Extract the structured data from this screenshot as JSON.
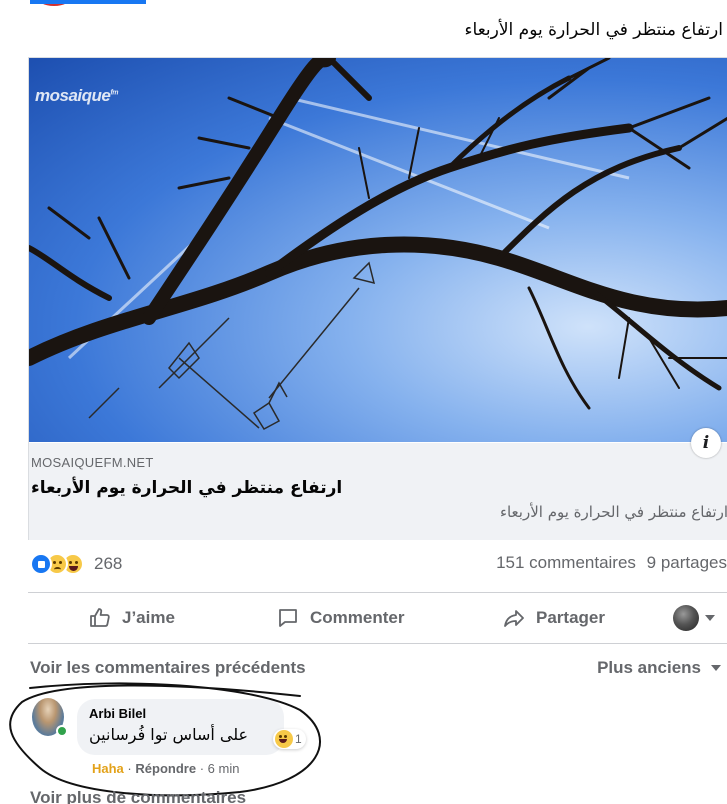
{
  "post": {
    "text": "ارتفاع منتظر في الحرارة يوم الأربعاء"
  },
  "link_preview": {
    "watermark": "mosaique",
    "watermark_suffix": "fm",
    "info_label": "i",
    "domain": "MOSAIQUEFM.NET",
    "title": "ارتفاع منتظر في الحرارة يوم الأربعاء",
    "subtitle": "ارتفاع منتظر في الحرارة يوم الأربعاء"
  },
  "stats": {
    "reaction_icons": [
      "like",
      "sad",
      "haha"
    ],
    "reaction_count": "268",
    "comments": "151 commentaires",
    "shares": "9 partages"
  },
  "actions": {
    "like": "J’aime",
    "comment": "Commenter",
    "share": "Partager"
  },
  "comments_section": {
    "previous": "Voir les commentaires précédents",
    "sort": "Plus anciens",
    "more": "Voir plus de commentaires"
  },
  "comment": {
    "author": "Arbi Bilel",
    "text": "على أساس توا فُرسانين",
    "reaction_count": "1",
    "reaction_label": "Haha",
    "separator1": "·",
    "reply_label": "Répondre",
    "separator2": "·",
    "time": "6 min"
  },
  "colors": {
    "accent": "#1877f2",
    "secondary_text": "#65676b",
    "haha": "#e3a21a",
    "online": "#31a24c"
  }
}
